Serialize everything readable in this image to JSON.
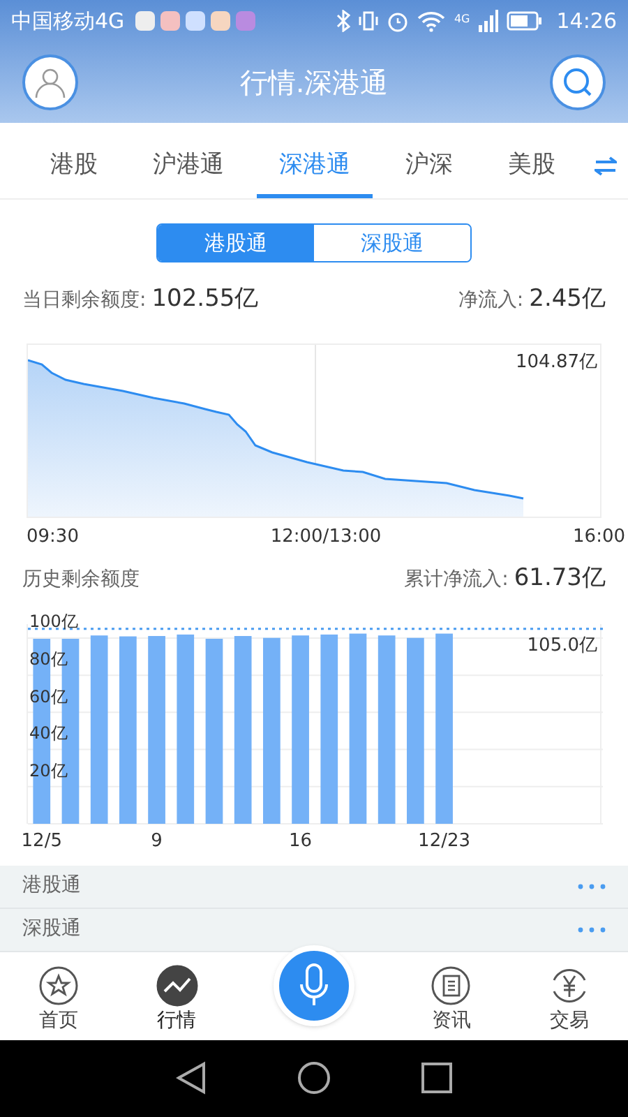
{
  "status_bar": {
    "carrier": "中国移动4G",
    "network": "4G",
    "time": "14:26"
  },
  "header": {
    "title": "行情.深港通"
  },
  "tabs": [
    {
      "label": "港股",
      "selected": false
    },
    {
      "label": "沪港通",
      "selected": false
    },
    {
      "label": "深港通",
      "selected": true
    },
    {
      "label": "沪深",
      "selected": false
    },
    {
      "label": "美股",
      "selected": false
    }
  ],
  "segments": [
    {
      "label": "港股通",
      "selected": true
    },
    {
      "label": "深股通",
      "selected": false
    }
  ],
  "today": {
    "label": "当日剩余额度:",
    "value": "102.55亿",
    "net_label": "净流入:",
    "net_value": "2.45亿"
  },
  "intraday_chart": {
    "top_label": "104.87亿",
    "x_labels": [
      "09:30",
      "12:00/13:00",
      "16:00"
    ]
  },
  "history": {
    "label": "历史剩余额度",
    "net_label": "累计净流入:",
    "net_value": "61.73亿",
    "chart_data": {
      "type": "bar",
      "categories": [
        "12/5",
        null,
        null,
        null,
        "9",
        null,
        null,
        null,
        null,
        "16",
        null,
        null,
        null,
        null,
        "12/23",
        null,
        null,
        null,
        null,
        null
      ],
      "ylim": [
        0,
        107.5
      ],
      "grid": true,
      "values": [
        99.6,
        99.6,
        101.4,
        100.9,
        101.1,
        101.9,
        99.6,
        101.1,
        100.1,
        101.4,
        101.9,
        102.4,
        101.4,
        100.1,
        102.4,
        null,
        null,
        null,
        null,
        null
      ],
      "yticks": [
        {
          "value": 20,
          "label": "20亿"
        },
        {
          "value": 40,
          "label": "40亿"
        },
        {
          "value": 60,
          "label": "60亿"
        },
        {
          "value": 80,
          "label": "80亿"
        },
        {
          "value": 100,
          "label": "100亿"
        }
      ],
      "ref_lines": [
        {
          "axis": "y",
          "value": 105,
          "label": "105.0亿"
        }
      ]
    }
  },
  "sections": [
    {
      "label": "港股通"
    },
    {
      "label": "深股通"
    }
  ],
  "nav": [
    {
      "label": "首页",
      "kind": "star",
      "selected": false
    },
    {
      "label": "行情",
      "kind": "chart",
      "selected": true
    },
    {
      "kind": "mic",
      "selected": false
    },
    {
      "label": "资讯",
      "kind": "news",
      "selected": false
    },
    {
      "label": "交易",
      "kind": "trade",
      "selected": false
    }
  ]
}
